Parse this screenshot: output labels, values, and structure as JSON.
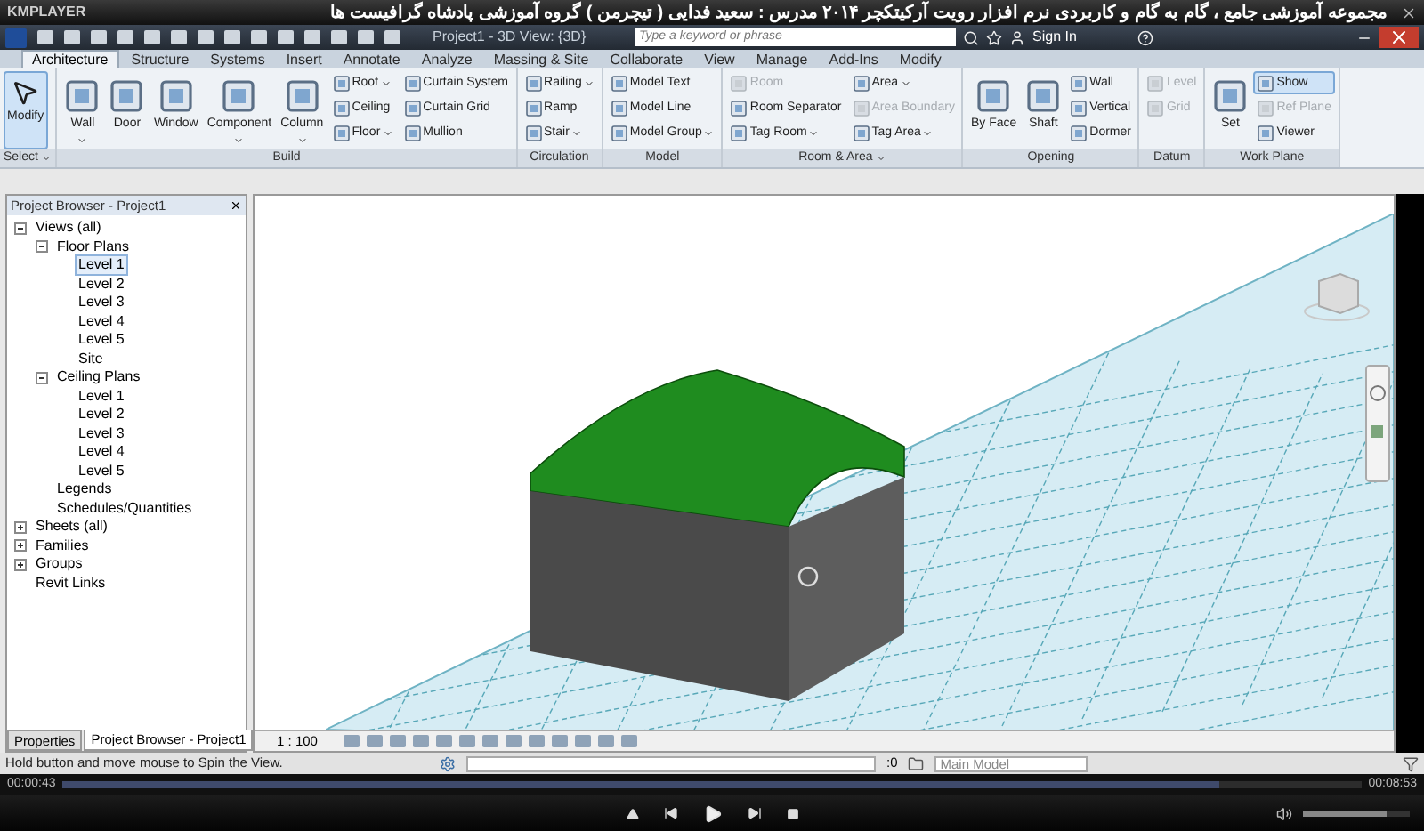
{
  "player": {
    "brand": "KMPLAYER",
    "title": "مجموعه آموزشی جامع ، گام به گام و کاربردی نرم افزار رویت آرکیتکچر ۲۰۱۴   مدرس : سعید فدایی ( تیچرمن ) گروه آموزشی پادشاه گرافیست ها"
  },
  "app": {
    "title": "Project1 - 3D View: {3D}",
    "search": {
      "placeholder": "Type a keyword or phrase"
    },
    "sign_in": "Sign In"
  },
  "tabs": [
    {
      "label": "Architecture",
      "selected": true
    },
    {
      "label": "Structure",
      "selected": false
    },
    {
      "label": "Systems",
      "selected": false
    },
    {
      "label": "Insert",
      "selected": false
    },
    {
      "label": "Annotate",
      "selected": false
    },
    {
      "label": "Analyze",
      "selected": false
    },
    {
      "label": "Massing & Site",
      "selected": false
    },
    {
      "label": "Collaborate",
      "selected": false
    },
    {
      "label": "View",
      "selected": false
    },
    {
      "label": "Manage",
      "selected": false
    },
    {
      "label": "Add-Ins",
      "selected": false
    },
    {
      "label": "Modify",
      "selected": false
    }
  ],
  "ribbon": [
    {
      "label": "Select",
      "dropdown": true,
      "items": [
        {
          "kind": "large",
          "label": "Modify",
          "selected": true,
          "disabled": false,
          "dropdown": false
        }
      ]
    },
    {
      "label": "Build",
      "dropdown": false,
      "items": [
        {
          "kind": "large",
          "label": "Wall",
          "selected": false,
          "disabled": false,
          "dropdown": true
        },
        {
          "kind": "large",
          "label": "Door",
          "selected": false,
          "disabled": false,
          "dropdown": false
        },
        {
          "kind": "large",
          "label": "Window",
          "selected": false,
          "disabled": false,
          "dropdown": false
        },
        {
          "kind": "large",
          "label": "Component",
          "selected": false,
          "disabled": false,
          "dropdown": true
        },
        {
          "kind": "large",
          "label": "Column",
          "selected": false,
          "disabled": false,
          "dropdown": true
        },
        {
          "kind": "small",
          "label": "Roof",
          "selected": false,
          "disabled": false,
          "dropdown": true
        },
        {
          "kind": "small",
          "label": "Ceiling",
          "selected": false,
          "disabled": false,
          "dropdown": false
        },
        {
          "kind": "small",
          "label": "Floor",
          "selected": false,
          "disabled": false,
          "dropdown": true
        },
        {
          "kind": "small",
          "label": "Curtain System",
          "selected": false,
          "disabled": false,
          "dropdown": false
        },
        {
          "kind": "small",
          "label": "Curtain Grid",
          "selected": false,
          "disabled": false,
          "dropdown": false
        },
        {
          "kind": "small",
          "label": "Mullion",
          "selected": false,
          "disabled": false,
          "dropdown": false
        }
      ]
    },
    {
      "label": "Circulation",
      "dropdown": false,
      "items": [
        {
          "kind": "small",
          "label": "Railing",
          "selected": false,
          "disabled": false,
          "dropdown": true
        },
        {
          "kind": "small",
          "label": "Ramp",
          "selected": false,
          "disabled": false,
          "dropdown": false
        },
        {
          "kind": "small",
          "label": "Stair",
          "selected": false,
          "disabled": false,
          "dropdown": true
        }
      ]
    },
    {
      "label": "Model",
      "dropdown": false,
      "items": [
        {
          "kind": "small",
          "label": "Model Text",
          "selected": false,
          "disabled": false,
          "dropdown": false
        },
        {
          "kind": "small",
          "label": "Model Line",
          "selected": false,
          "disabled": false,
          "dropdown": false
        },
        {
          "kind": "small",
          "label": "Model Group",
          "selected": false,
          "disabled": false,
          "dropdown": true
        }
      ]
    },
    {
      "label": "Room & Area",
      "dropdown": true,
      "items": [
        {
          "kind": "small",
          "label": "Room",
          "selected": false,
          "disabled": true,
          "dropdown": false
        },
        {
          "kind": "small",
          "label": "Room Separator",
          "selected": false,
          "disabled": false,
          "dropdown": false
        },
        {
          "kind": "small",
          "label": "Tag Room",
          "selected": false,
          "disabled": false,
          "dropdown": true
        },
        {
          "kind": "small",
          "label": "Area",
          "selected": false,
          "disabled": false,
          "dropdown": true
        },
        {
          "kind": "small",
          "label": "Area Boundary",
          "selected": false,
          "disabled": true,
          "dropdown": false
        },
        {
          "kind": "small",
          "label": "Tag Area",
          "selected": false,
          "disabled": false,
          "dropdown": true
        }
      ]
    },
    {
      "label": "Opening",
      "dropdown": false,
      "items": [
        {
          "kind": "large",
          "label": "By Face",
          "selected": false,
          "disabled": false,
          "dropdown": false
        },
        {
          "kind": "large",
          "label": "Shaft",
          "selected": false,
          "disabled": false,
          "dropdown": false
        },
        {
          "kind": "small",
          "label": "Wall",
          "selected": false,
          "disabled": false,
          "dropdown": false
        },
        {
          "kind": "small",
          "label": "Vertical",
          "selected": false,
          "disabled": false,
          "dropdown": false
        },
        {
          "kind": "small",
          "label": "Dormer",
          "selected": false,
          "disabled": false,
          "dropdown": false
        }
      ]
    },
    {
      "label": "Datum",
      "dropdown": false,
      "items": [
        {
          "kind": "small",
          "label": "Level",
          "selected": false,
          "disabled": true,
          "dropdown": false
        },
        {
          "kind": "small",
          "label": "Grid",
          "selected": false,
          "disabled": true,
          "dropdown": false
        }
      ]
    },
    {
      "label": "Work Plane",
      "dropdown": false,
      "items": [
        {
          "kind": "large",
          "label": "Set",
          "selected": false,
          "disabled": false,
          "dropdown": false
        },
        {
          "kind": "small",
          "label": "Show",
          "selected": true,
          "disabled": false,
          "dropdown": false
        },
        {
          "kind": "small",
          "label": "Ref Plane",
          "selected": false,
          "disabled": true,
          "dropdown": false
        },
        {
          "kind": "small",
          "label": "Viewer",
          "selected": false,
          "disabled": false,
          "dropdown": false
        }
      ]
    }
  ],
  "browser": {
    "title": "Project Browser - Project1",
    "tree": [
      {
        "label": "Views (all)",
        "expanded": true,
        "selected": false,
        "children": [
          {
            "label": "Floor Plans",
            "expanded": true,
            "selected": false,
            "children": [
              {
                "label": "Level 1",
                "selected": true
              },
              {
                "label": "Level 2",
                "selected": false
              },
              {
                "label": "Level 3",
                "selected": false
              },
              {
                "label": "Level 4",
                "selected": false
              },
              {
                "label": "Level 5",
                "selected": false
              },
              {
                "label": "Site",
                "selected": false
              }
            ]
          },
          {
            "label": "Ceiling Plans",
            "expanded": true,
            "selected": false,
            "children": [
              {
                "label": "Level 1",
                "selected": false
              },
              {
                "label": "Level 2",
                "selected": false
              },
              {
                "label": "Level 3",
                "selected": false
              },
              {
                "label": "Level 4",
                "selected": false
              },
              {
                "label": "Level 5",
                "selected": false
              }
            ]
          },
          {
            "label": "Legends",
            "selected": false
          },
          {
            "label": "Schedules/Quantities",
            "selected": false
          }
        ]
      },
      {
        "label": "Sheets (all)",
        "expanded": false,
        "selected": false
      },
      {
        "label": "Families",
        "expanded": false,
        "selected": false
      },
      {
        "label": "Groups",
        "expanded": false,
        "selected": false
      },
      {
        "label": "Revit Links",
        "selected": false
      }
    ],
    "tabs": [
      {
        "label": "Properties",
        "selected": false
      },
      {
        "label": "Project Browser - Project1",
        "selected": true
      }
    ]
  },
  "view": {
    "scale": "1 : 100"
  },
  "status": {
    "message": "Hold button and move mouse to Spin the View.",
    "count": ":0",
    "model": "Main Model"
  },
  "seek": {
    "elapsed": "00:00:43",
    "total": "00:08:53",
    "level": 0.89
  },
  "volume": {
    "level": 0.78
  }
}
